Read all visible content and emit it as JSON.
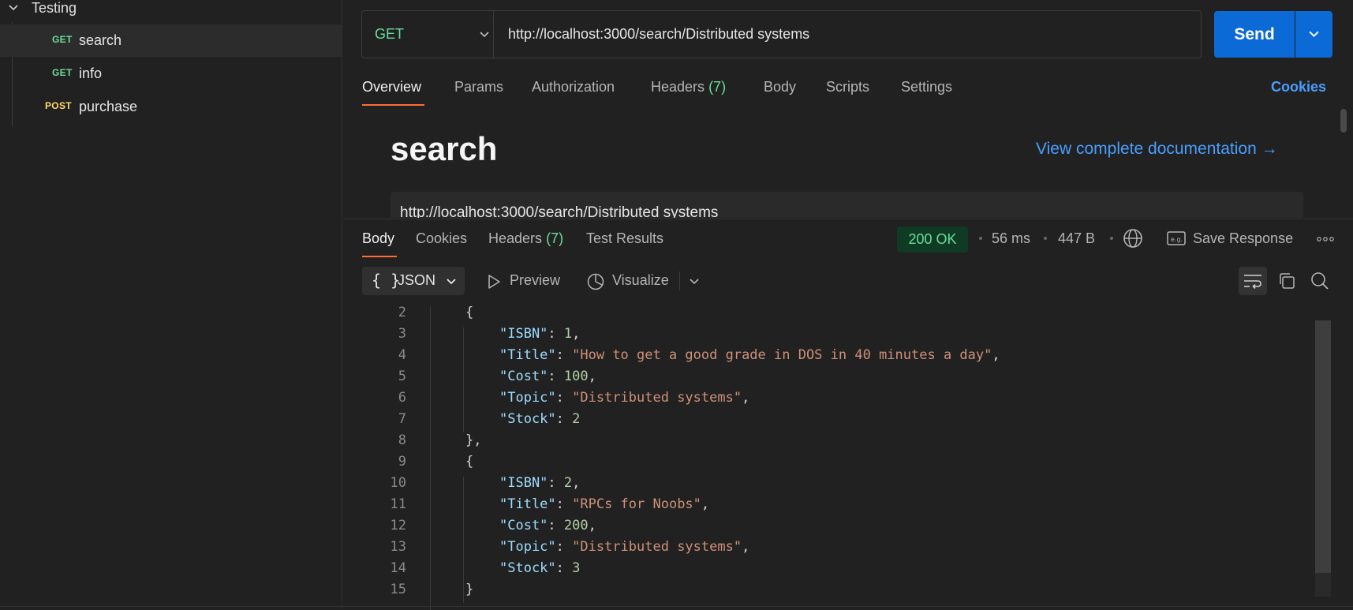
{
  "sidebar": {
    "folder": "Testing",
    "items": [
      {
        "method": "GET",
        "name": "search",
        "selected": true
      },
      {
        "method": "GET",
        "name": "info",
        "selected": false
      },
      {
        "method": "POST",
        "name": "purchase",
        "selected": false
      }
    ]
  },
  "request": {
    "method": "GET",
    "url": "http://localhost:3000/search/Distributed systems",
    "send_label": "Send"
  },
  "request_tabs": {
    "overview": "Overview",
    "params": "Params",
    "authorization": "Authorization",
    "headers": "Headers",
    "headers_count": "(7)",
    "body": "Body",
    "scripts": "Scripts",
    "settings": "Settings",
    "cookies": "Cookies"
  },
  "doc": {
    "title": "search",
    "link": "View complete documentation →",
    "url": "http://localhost:3000/search/Distributed systems"
  },
  "response": {
    "tabs": {
      "body": "Body",
      "cookies": "Cookies",
      "headers": "Headers",
      "headers_count": "(7)",
      "test_results": "Test Results"
    },
    "status": "200 OK",
    "time": "56 ms",
    "size": "447 B",
    "save_label": "Save Response",
    "format": "JSON",
    "preview_label": "Preview",
    "visualize_label": "Visualize"
  },
  "code": {
    "lines": [
      {
        "n": "2",
        "text": "{"
      },
      {
        "n": "3",
        "key": "\"ISBN\"",
        "num": "1",
        "tail": ","
      },
      {
        "n": "4",
        "key": "\"Title\"",
        "str": "\"How to get a good grade in DOS in 40 minutes a day\"",
        "tail": ","
      },
      {
        "n": "5",
        "key": "\"Cost\"",
        "num": "100",
        "tail": ","
      },
      {
        "n": "6",
        "key": "\"Topic\"",
        "str": "\"Distributed systems\"",
        "tail": ","
      },
      {
        "n": "7",
        "key": "\"Stock\"",
        "num": "2",
        "tail": ""
      },
      {
        "n": "8",
        "text": "},"
      },
      {
        "n": "9",
        "text": "{"
      },
      {
        "n": "10",
        "key": "\"ISBN\"",
        "num": "2",
        "tail": ","
      },
      {
        "n": "11",
        "key": "\"Title\"",
        "str": "\"RPCs for Noobs\"",
        "tail": ","
      },
      {
        "n": "12",
        "key": "\"Cost\"",
        "num": "200",
        "tail": ","
      },
      {
        "n": "13",
        "key": "\"Topic\"",
        "str": "\"Distributed systems\"",
        "tail": ","
      },
      {
        "n": "14",
        "key": "\"Stock\"",
        "num": "3",
        "tail": ""
      },
      {
        "n": "15",
        "text": "}"
      }
    ]
  },
  "colors": {
    "accent_tab": "#ff6c37",
    "send_blue": "#0b6ad6",
    "get_green": "#6bdd9a",
    "post_yellow": "#ffd96a",
    "link_blue": "#4a9eff"
  }
}
